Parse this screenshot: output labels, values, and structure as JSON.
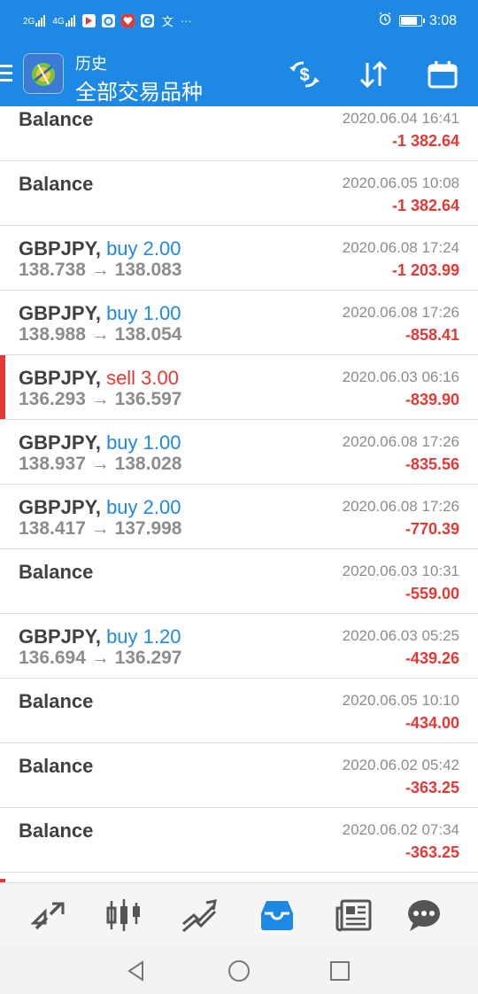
{
  "status_bar": {
    "network_labels": [
      "2G",
      "4G"
    ],
    "misc_glyph": "文",
    "more": "···",
    "time": "3:08",
    "battery_level": 0.85,
    "alarm_icon": "alarm-icon"
  },
  "header": {
    "title": "历史",
    "subtitle": "全部交易品种",
    "menu_icon": "hamburger-icon",
    "buttons": [
      {
        "name": "currency-exchange-icon"
      },
      {
        "name": "sort-icon"
      },
      {
        "name": "calendar-icon"
      }
    ]
  },
  "colors": {
    "accent": "#1e88e5",
    "loss": "#e53935",
    "buy": "#1e88e5",
    "sell": "#e53935",
    "muted": "#8c8c8c"
  },
  "rows": [
    {
      "title": "Balance",
      "time": "2020.06.04 16:41",
      "profit": "-1 382.64"
    },
    {
      "title": "Balance",
      "time": "2020.06.05 10:08",
      "profit": "-1 382.64"
    },
    {
      "symbol": "GBPJPY,",
      "action": "buy 2.00",
      "side": "buy",
      "prices": "138.738 → 138.083",
      "time": "2020.06.08 17:24",
      "profit": "-1 203.99"
    },
    {
      "symbol": "GBPJPY,",
      "action": "buy 1.00",
      "side": "buy",
      "prices": "138.988 → 138.054",
      "time": "2020.06.08 17:26",
      "profit": "-858.41"
    },
    {
      "symbol": "GBPJPY,",
      "action": "sell 3.00",
      "side": "sell",
      "prices": "136.293 → 136.597",
      "time": "2020.06.03 06:16",
      "profit": "-839.90"
    },
    {
      "symbol": "GBPJPY,",
      "action": "buy 1.00",
      "side": "buy",
      "prices": "138.937 → 138.028",
      "time": "2020.06.08 17:26",
      "profit": "-835.56"
    },
    {
      "symbol": "GBPJPY,",
      "action": "buy 2.00",
      "side": "buy",
      "prices": "138.417 → 137.998",
      "time": "2020.06.08 17:26",
      "profit": "-770.39"
    },
    {
      "title": "Balance",
      "time": "2020.06.03 10:31",
      "profit": "-559.00"
    },
    {
      "symbol": "GBPJPY,",
      "action": "buy 1.20",
      "side": "buy",
      "prices": "136.694 → 136.297",
      "time": "2020.06.03 05:25",
      "profit": "-439.26"
    },
    {
      "title": "Balance",
      "time": "2020.06.05 10:10",
      "profit": "-434.00"
    },
    {
      "title": "Balance",
      "time": "2020.06.02 05:42",
      "profit": "-363.25"
    },
    {
      "title": "Balance",
      "time": "2020.06.02 07:34",
      "profit": "-363.25"
    }
  ],
  "bottom_nav": [
    {
      "name": "quotes-icon",
      "active": false
    },
    {
      "name": "chart-icon",
      "active": false
    },
    {
      "name": "trade-icon",
      "active": false
    },
    {
      "name": "history-icon",
      "active": true
    },
    {
      "name": "news-icon",
      "active": false
    },
    {
      "name": "messages-icon",
      "active": false
    }
  ],
  "system_nav": [
    {
      "name": "back-icon"
    },
    {
      "name": "home-icon"
    },
    {
      "name": "recents-icon"
    }
  ]
}
